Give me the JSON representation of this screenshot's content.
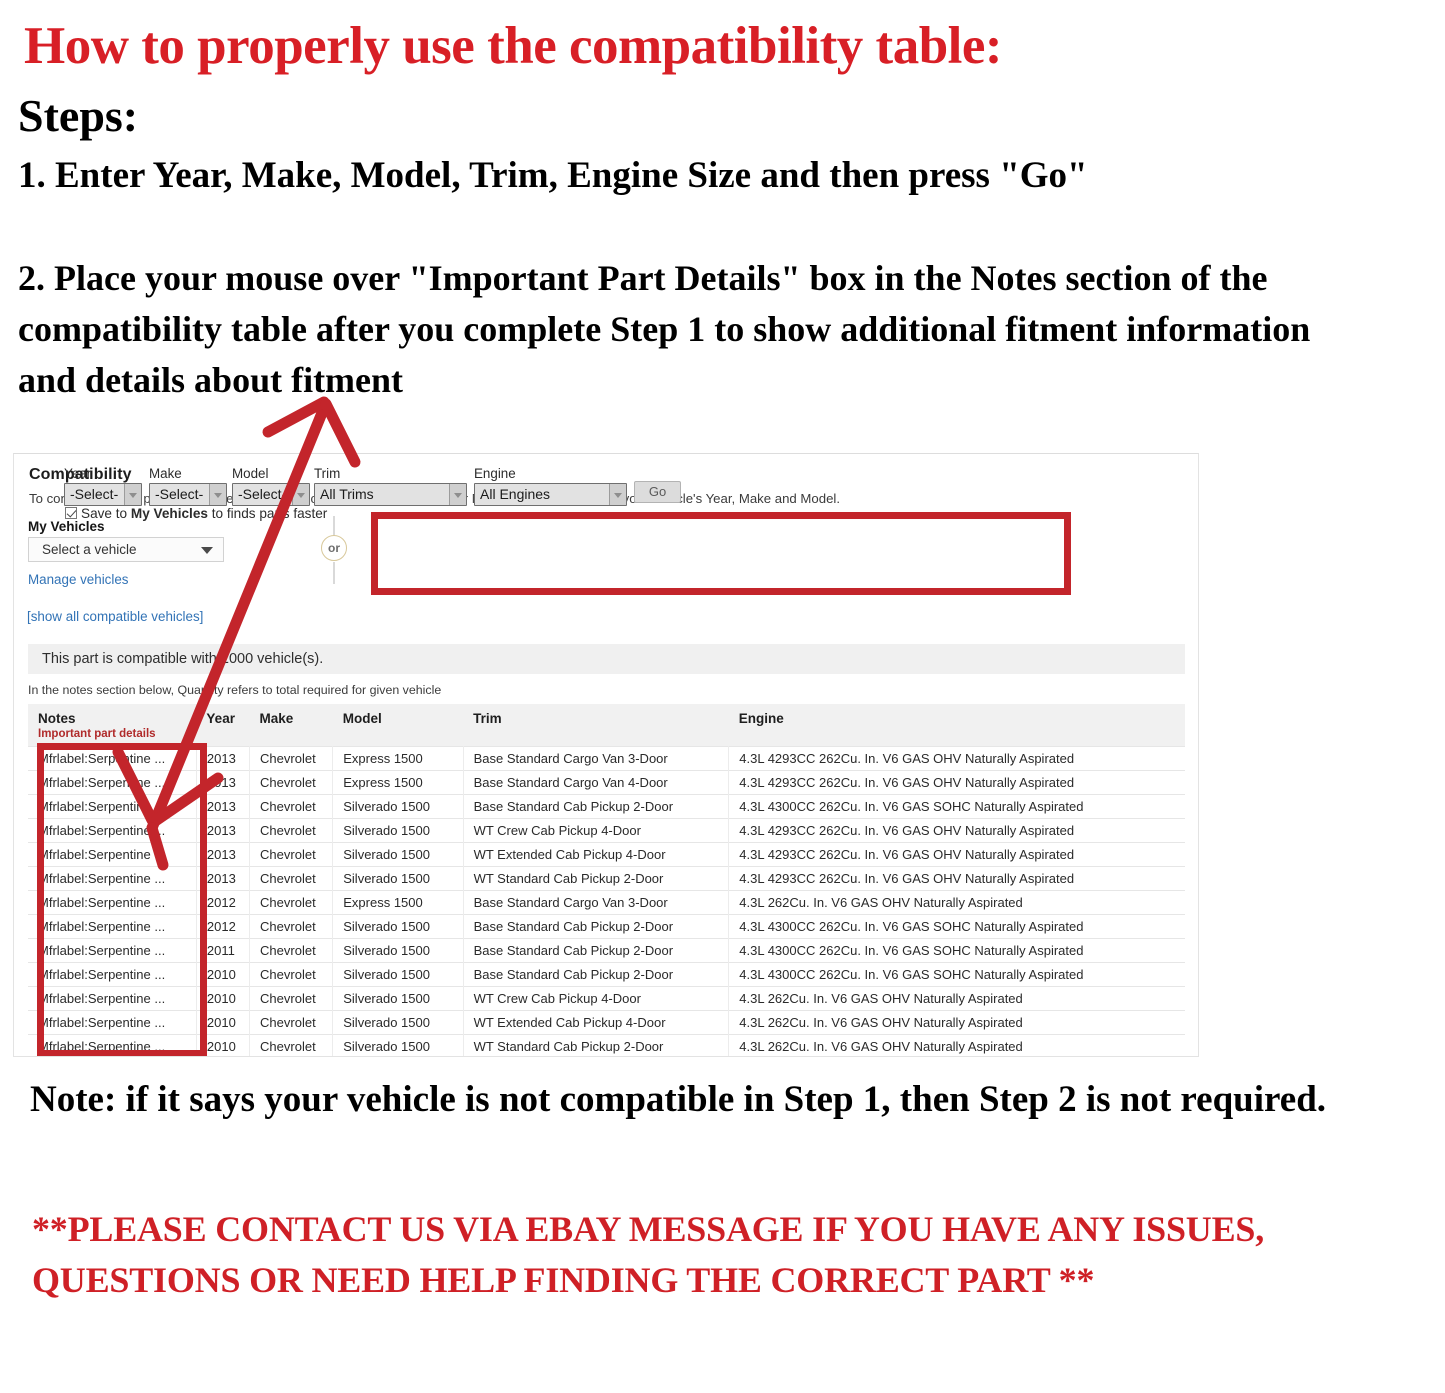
{
  "headings": {
    "main_title": "How to properly use the compatibility table:",
    "steps_label": "Steps:",
    "step1": "1. Enter Year, Make, Model, Trim, Engine Size and then press \"Go\"",
    "step2": "2. Place your mouse over \"Important Part Details\" box in the Notes section of the compatibility table after you complete Step 1 to show additional fitment information and details about fitment",
    "note": "Note: if it says your vehicle is not compatible in Step 1, then Step 2 is not required.",
    "contact": "**PLEASE CONTACT US VIA EBAY MESSAGE IF YOU HAVE ANY ISSUES, QUESTIONS OR NEED HELP FINDING THE CORRECT PART **"
  },
  "colors": {
    "heading_red": "#d81f26",
    "contact_red": "#cf2026",
    "annotation_red": "#c3252b",
    "link_blue": "#3273b6",
    "important_maroon": "#b02a2a"
  },
  "panel": {
    "title": "Compatibility",
    "subtitle": "To confirm that this part fits your vehicle, please choose a vehicle from your My Vehicles list OR enter your vehicle's Year, Make and Model.",
    "my_vehicles_label": "My Vehicles",
    "my_vehicles_value": "Select a vehicle",
    "manage_vehicles_link": "Manage vehicles",
    "show_all_link": "[show all compatible vehicles]",
    "or_label": "or",
    "compatible_banner": "This part is compatible with 1000 vehicle(s).",
    "quantity_note": "In the notes section below, Quantity refers to total required for given vehicle"
  },
  "form": {
    "fields": [
      {
        "label": "Year",
        "value": "-Select-"
      },
      {
        "label": "Make",
        "value": "-Select-"
      },
      {
        "label": "Model",
        "value": "-Select-"
      },
      {
        "label": "Trim",
        "value": "All Trims"
      },
      {
        "label": "Engine",
        "value": "All Engines"
      }
    ],
    "go_button": "Go",
    "save_checkbox_checked": true,
    "save_text_1": "Save to ",
    "save_text_bold": "My Vehicles",
    "save_text_2": " to finds parts faster"
  },
  "table": {
    "headers": {
      "notes": "Notes",
      "notes_sub": "Important part details",
      "year": "Year",
      "make": "Make",
      "model": "Model",
      "trim": "Trim",
      "engine": "Engine"
    },
    "rows": [
      {
        "notes": "Mfrlabel:Serpentine ...",
        "year": "2013",
        "make": "Chevrolet",
        "model": "Express 1500",
        "trim": "Base Standard Cargo Van 3-Door",
        "engine": "4.3L 4293CC 262Cu. In. V6 GAS OHV Naturally Aspirated"
      },
      {
        "notes": "Mfrlabel:Serpentine ...",
        "year": "2013",
        "make": "Chevrolet",
        "model": "Express 1500",
        "trim": "Base Standard Cargo Van 4-Door",
        "engine": "4.3L 4293CC 262Cu. In. V6 GAS OHV Naturally Aspirated"
      },
      {
        "notes": "Mfrlabel:Serpentine ...",
        "year": "2013",
        "make": "Chevrolet",
        "model": "Silverado 1500",
        "trim": "Base Standard Cab Pickup 2-Door",
        "engine": "4.3L 4300CC 262Cu. In. V6 GAS SOHC Naturally Aspirated"
      },
      {
        "notes": "Mfrlabel:Serpentine ...",
        "year": "2013",
        "make": "Chevrolet",
        "model": "Silverado 1500",
        "trim": "WT Crew Cab Pickup 4-Door",
        "engine": "4.3L 4293CC 262Cu. In. V6 GAS OHV Naturally Aspirated"
      },
      {
        "notes": "Mfrlabel:Serpentine ...",
        "year": "2013",
        "make": "Chevrolet",
        "model": "Silverado 1500",
        "trim": "WT Extended Cab Pickup 4-Door",
        "engine": "4.3L 4293CC 262Cu. In. V6 GAS OHV Naturally Aspirated"
      },
      {
        "notes": "Mfrlabel:Serpentine ...",
        "year": "2013",
        "make": "Chevrolet",
        "model": "Silverado 1500",
        "trim": "WT Standard Cab Pickup 2-Door",
        "engine": "4.3L 4293CC 262Cu. In. V6 GAS OHV Naturally Aspirated"
      },
      {
        "notes": "Mfrlabel:Serpentine ...",
        "year": "2012",
        "make": "Chevrolet",
        "model": "Express 1500",
        "trim": "Base Standard Cargo Van 3-Door",
        "engine": "4.3L 262Cu. In. V6 GAS OHV Naturally Aspirated"
      },
      {
        "notes": "Mfrlabel:Serpentine ...",
        "year": "2012",
        "make": "Chevrolet",
        "model": "Silverado 1500",
        "trim": "Base Standard Cab Pickup 2-Door",
        "engine": "4.3L 4300CC 262Cu. In. V6 GAS SOHC Naturally Aspirated"
      },
      {
        "notes": "Mfrlabel:Serpentine ...",
        "year": "2011",
        "make": "Chevrolet",
        "model": "Silverado 1500",
        "trim": "Base Standard Cab Pickup 2-Door",
        "engine": "4.3L 4300CC 262Cu. In. V6 GAS SOHC Naturally Aspirated"
      },
      {
        "notes": "Mfrlabel:Serpentine ...",
        "year": "2010",
        "make": "Chevrolet",
        "model": "Silverado 1500",
        "trim": "Base Standard Cab Pickup 2-Door",
        "engine": "4.3L 4300CC 262Cu. In. V6 GAS SOHC Naturally Aspirated"
      },
      {
        "notes": "Mfrlabel:Serpentine ...",
        "year": "2010",
        "make": "Chevrolet",
        "model": "Silverado 1500",
        "trim": "WT Crew Cab Pickup 4-Door",
        "engine": "4.3L 262Cu. In. V6 GAS OHV Naturally Aspirated"
      },
      {
        "notes": "Mfrlabel:Serpentine ...",
        "year": "2010",
        "make": "Chevrolet",
        "model": "Silverado 1500",
        "trim": "WT Extended Cab Pickup 4-Door",
        "engine": "4.3L 262Cu. In. V6 GAS OHV Naturally Aspirated"
      },
      {
        "notes": "Mfrlabel:Serpentine ...",
        "year": "2010",
        "make": "Chevrolet",
        "model": "Silverado 1500",
        "trim": "WT Standard Cab Pickup 2-Door",
        "engine": "4.3L 262Cu. In. V6 GAS OHV Naturally Aspirated"
      }
    ]
  }
}
